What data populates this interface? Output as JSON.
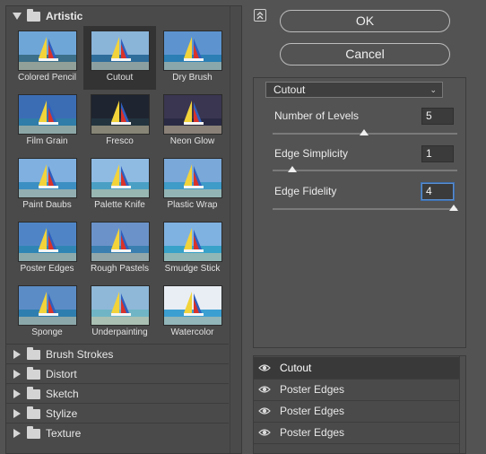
{
  "filter_browser": {
    "open_category": {
      "label": "Artistic"
    },
    "tiles": [
      {
        "label": "Colored Pencil"
      },
      {
        "label": "Cutout",
        "selected": true
      },
      {
        "label": "Dry Brush"
      },
      {
        "label": "Film Grain"
      },
      {
        "label": "Fresco"
      },
      {
        "label": "Neon Glow"
      },
      {
        "label": "Paint Daubs"
      },
      {
        "label": "Palette Knife"
      },
      {
        "label": "Plastic Wrap"
      },
      {
        "label": "Poster Edges"
      },
      {
        "label": "Rough Pastels"
      },
      {
        "label": "Smudge Stick"
      },
      {
        "label": "Sponge"
      },
      {
        "label": "Underpainting"
      },
      {
        "label": "Watercolor"
      }
    ],
    "collapsed_categories": [
      {
        "label": "Brush Strokes"
      },
      {
        "label": "Distort"
      },
      {
        "label": "Sketch"
      },
      {
        "label": "Stylize"
      },
      {
        "label": "Texture"
      }
    ]
  },
  "buttons": {
    "ok": "OK",
    "cancel": "Cancel"
  },
  "settings": {
    "filter_select": "Cutout",
    "params": [
      {
        "label": "Number of Levels",
        "value": "5",
        "level_fraction": 0.5,
        "focused": false
      },
      {
        "label": "Edge Simplicity",
        "value": "1",
        "level_fraction": 0.1,
        "focused": false
      },
      {
        "label": "Edge Fidelity",
        "value": "4",
        "level_fraction": 1.0,
        "focused": true
      }
    ]
  },
  "effect_layers": [
    {
      "label": "Cutout",
      "selected": true
    },
    {
      "label": "Poster Edges",
      "selected": false
    },
    {
      "label": "Poster Edges",
      "selected": false
    },
    {
      "label": "Poster Edges",
      "selected": false
    }
  ],
  "colors": {
    "panel": "#535353",
    "accent_focus": "#5a8fd1",
    "selected_tile": "#333333"
  },
  "icons": {
    "collapse": "collapse-up-icon",
    "eye": "eye-icon",
    "folder": "folder-icon"
  }
}
